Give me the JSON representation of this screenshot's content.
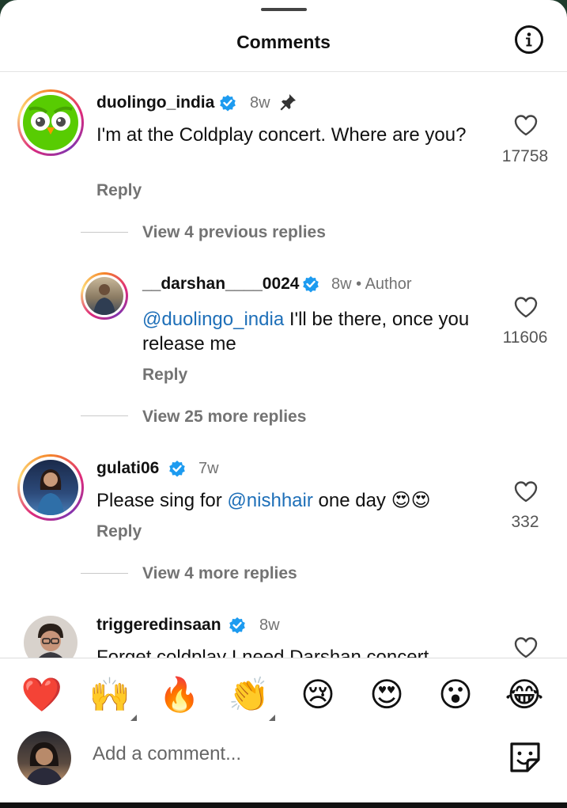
{
  "header": {
    "title": "Comments"
  },
  "comments": [
    {
      "username": "duolingo_india",
      "time": "8w",
      "text": "I'm at the Coldplay concert. Where are you?",
      "reply_label": "Reply",
      "likes": "17758",
      "thread_label": "View 4 previous replies",
      "reply": {
        "username": "__darshan____0024",
        "time": "8w",
        "author_tag": "Author",
        "mention": "@duolingo_india",
        "text": " I'll be there, once you release me",
        "reply_label": "Reply",
        "likes": "11606"
      },
      "thread_label_2": "View 25 more replies"
    },
    {
      "username": "gulati06",
      "time": "7w",
      "text_before": "Please sing for ",
      "mention": "@nishhair",
      "text_after": " one day 😍😍",
      "reply_label": "Reply",
      "likes": "332",
      "thread_label": "View 4 more replies"
    },
    {
      "username": "triggeredinsaan",
      "time": "8w",
      "text": "Forget coldplay I need Darshan concert"
    }
  ],
  "emoji_bar": [
    "❤️",
    "🙌",
    "🔥",
    "👏",
    "😢",
    "😍",
    "😮",
    "😂"
  ],
  "composer": {
    "placeholder": "Add a comment..."
  },
  "colors": {
    "mention": "#1e6fb8",
    "verified": "#1d9bf0",
    "muted": "#737373"
  }
}
